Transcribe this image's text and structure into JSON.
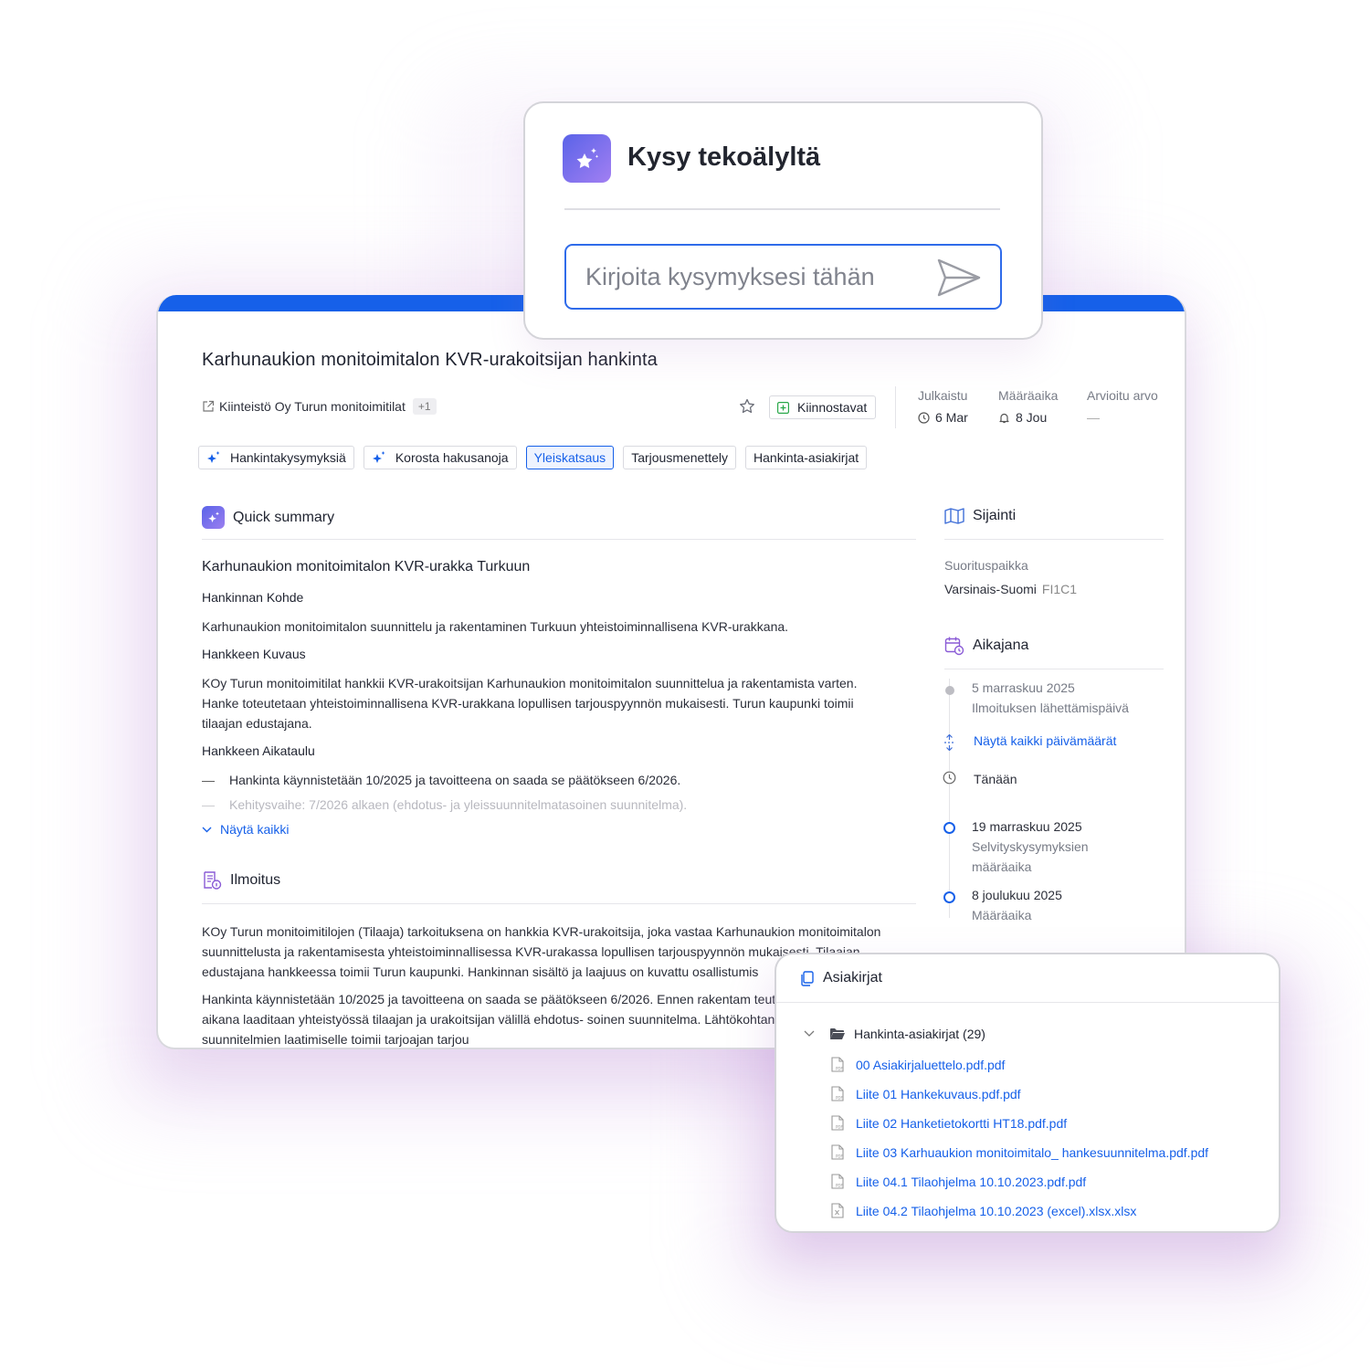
{
  "ai_card": {
    "title": "Kysy tekoälyltä",
    "input_placeholder": "Kirjoita kysymyksesi tähän",
    "icon": "sparkle-star-icon",
    "send_icon": "send-icon"
  },
  "procurement": {
    "title": "Karhunaukion monitoimitalon KVR-urakoitsijan hankinta",
    "buyer": "Kiinteistö Oy Turun monitoimitilat",
    "buyer_more": "+1",
    "interest_button": "Kiinnostavat",
    "meta": {
      "published_label": "Julkaistu",
      "published_value": "6 Mar",
      "deadline_label": "Määräaika",
      "deadline_value": "8 Jou",
      "value_label": "Arvioitu arvo",
      "value_value": "—"
    },
    "tabs": [
      {
        "label": "Hankintakysymyksiä",
        "ai": true,
        "active": false
      },
      {
        "label": "Korosta hakusanoja",
        "ai": true,
        "active": false
      },
      {
        "label": "Yleiskatsaus",
        "ai": false,
        "active": true
      },
      {
        "label": "Tarjousmenettely",
        "ai": false,
        "active": false
      },
      {
        "label": "Hankinta-asiakirjat",
        "ai": false,
        "active": false
      }
    ]
  },
  "summary": {
    "heading": "Quick summary",
    "title": "Karhunaukion monitoimitalon KVR-urakka Turkuun",
    "subject_heading": "Hankinnan Kohde",
    "subject_text": "Karhunaukion monitoimitalon suunnittelu ja rakentaminen Turkuun yhteistoiminnallisena KVR-urakkana.",
    "description_heading": "Hankkeen Kuvaus",
    "description_text": "KOy Turun monitoimitilat hankkii KVR-urakoitsijan Karhunaukion monitoimitalon suunnittelua ja rakentamista varten. Hanke toteutetaan yhteistoiminnallisena KVR-urakkana lopullisen tarjouspyynnön mukaisesti. Turun kaupunki toimii tilaajan edustajana.",
    "schedule_heading": "Hankkeen Aikataulu",
    "schedule_items": [
      "Hankinta käynnistetään 10/2025 ja tavoitteena on saada se päätökseen 6/2026.",
      "Kehitysvaihe: 7/2026 alkaen (ehdotus- ja yleissuunnitelmatasoinen suunnitelma)."
    ],
    "show_all": "Näytä kaikki"
  },
  "notice": {
    "heading": "Ilmoitus",
    "paragraphs": [
      "KOy Turun monitoimitilojen (Tilaaja) tarkoituksena on hankkia KVR-urakoitsija, joka vastaa Karhunaukion monitoimitalon suunnittelusta ja rakentamisesta yhteistoiminnallisessa KVR-urakassa lopullisen tarjouspyynnön mukaisesti. Tilaajan edustajana hankkeessa toimii Turun kaupunki. Hankinnan sisältö ja laajuus on kuvattu osallistumis",
      "Hankinta käynnistetään 10/2025 ja tavoitteena on saada se päätökseen 6/2026. Ennen rakentam teutetaan kehitysvaihe, jonka aikana laaditaan yhteistyössä tilaajan ja urakoitsijan välillä ehdotus- soinen suunnitelma. Lähtökohtana kehitysvaiheen suunnitelmien laatimiselle toimii tarjoajan tarjou"
    ]
  },
  "location": {
    "heading": "Sijainti",
    "place_label": "Suorituspaikka",
    "place_value": "Varsinais-Suomi",
    "place_code": "FI1C1"
  },
  "timeline": {
    "heading": "Aikajana",
    "items": [
      {
        "date": "5 marraskuu 2025",
        "label": "Ilmoituksen lähettämispäivä"
      },
      {
        "date": "19 marraskuu 2025",
        "label": "Selvityskysymyksien määräaika"
      },
      {
        "date": "8 joulukuu 2025",
        "label": "Määräaika"
      }
    ],
    "show_all_dates": "Näytä kaikki päivämäärät",
    "today": "Tänään"
  },
  "documents": {
    "heading": "Asiakirjat",
    "folder": "Hankinta-asiakirjat (29)",
    "files": [
      {
        "name": "00 Asiakirjaluettelo.pdf.pdf",
        "type": "pdf"
      },
      {
        "name": "Liite 01 Hankekuvaus.pdf.pdf",
        "type": "pdf"
      },
      {
        "name": "Liite 02 Hanketietokortti HT18.pdf.pdf",
        "type": "pdf"
      },
      {
        "name": "Liite 03 Karhuaukion monitoimitalo_ hankesuunnitelma.pdf.pdf",
        "type": "pdf"
      },
      {
        "name": "Liite 04.1 Tilaohjelma 10.10.2023.pdf.pdf",
        "type": "pdf"
      },
      {
        "name": "Liite 04.2 Tilaohjelma 10.10.2023 (excel).xlsx.xlsx",
        "type": "xlsx"
      }
    ]
  },
  "colors": {
    "accent": "#1660e9",
    "ai_gradient_start": "#5a63e8",
    "ai_gradient_end": "#a27ff2"
  }
}
